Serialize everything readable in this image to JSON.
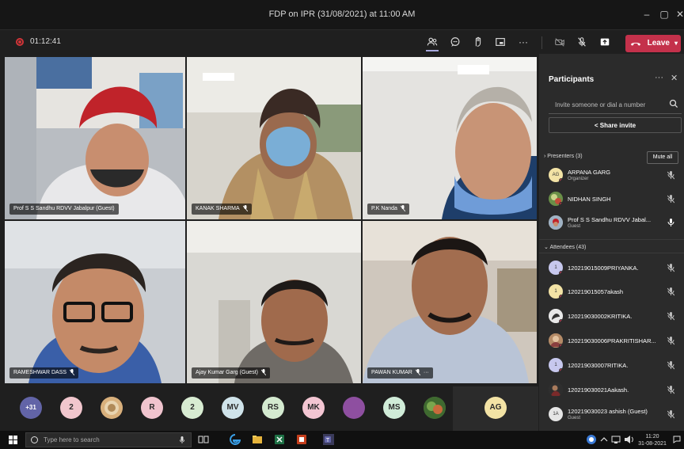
{
  "window": {
    "title": "FDP on IPR (31/08/2021) at 11:00 AM",
    "minimize": "–",
    "maximize": "▢",
    "close": "✕"
  },
  "meeting": {
    "elapsed": "01:12:41",
    "leave_label": "Leave",
    "more": "···"
  },
  "tiles": [
    {
      "name": "Prof S S Sandhu RDVV Jabalpur (Guest)"
    },
    {
      "name": "KANAK SHARMA"
    },
    {
      "name": "P.K Nanda"
    },
    {
      "name": "RAMESHWAR DASS"
    },
    {
      "name": "Ajay Kumar Garg (Guest)"
    },
    {
      "name": "PAWAN KUMAR",
      "more": "···"
    }
  ],
  "strip": {
    "overflow": "+31",
    "avatars": [
      "2",
      "R",
      "2",
      "MV",
      "RS",
      "MK",
      "MS",
      "AG"
    ]
  },
  "participants": {
    "title": "Participants",
    "more": "···",
    "close": "✕",
    "invite_placeholder": "Invite someone or dial a number",
    "share_invite": "Share invite",
    "presenters_header": "Presenters (3)",
    "mute_all": "Mute all",
    "presenters": [
      {
        "initials": "AG",
        "name": "ARPANA GARG",
        "sub": "Organizer"
      },
      {
        "initials": "",
        "name": "NIDHAN SINGH",
        "sub": ""
      },
      {
        "initials": "",
        "name": "Prof S S Sandhu RDVV Jabal...",
        "sub": "Guest"
      }
    ],
    "attendees_header": "Attendees (43)",
    "attendees": [
      {
        "initials": "1",
        "name": "120219015009PRIYANKA.",
        "sub": ""
      },
      {
        "initials": "1",
        "name": "120219015057akash",
        "sub": ""
      },
      {
        "initials": "",
        "name": "120219030002KRITIKA.",
        "sub": ""
      },
      {
        "initials": "",
        "name": "120219030006PRAKRITISHAR...",
        "sub": ""
      },
      {
        "initials": "1",
        "name": "120219030007RITIKA.",
        "sub": ""
      },
      {
        "initials": "",
        "name": "120219030021Aakash.",
        "sub": ""
      },
      {
        "initials": "1A",
        "name": "120219030023 ashish (Guest)",
        "sub": "Guest"
      }
    ]
  },
  "taskbar": {
    "search_placeholder": "Type here to search",
    "time": "11:20",
    "date": "31-08-2021"
  },
  "colors": {
    "leave": "#c4314b",
    "accent": "#a6a7dc",
    "panel": "#2b2b2b"
  }
}
